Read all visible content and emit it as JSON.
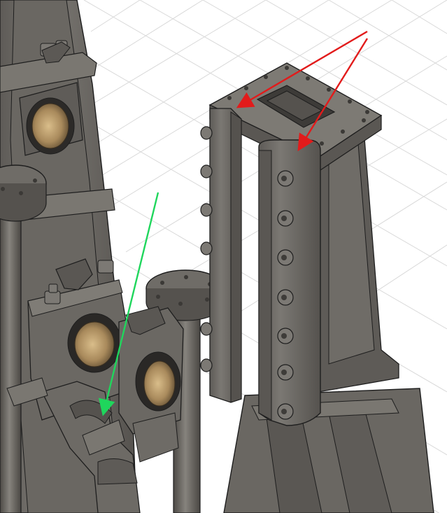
{
  "viewport": {
    "background": "#ffffff",
    "grid_color": "#d9d9d9"
  },
  "model": {
    "body_color": "#6e6b66",
    "shadow_color": "#4a4845",
    "edge_color": "#1e1e1e",
    "highlight_color": "#8a8781",
    "bronze_color": "#b89a6c",
    "bronze_shadow": "#6f5a3c",
    "bolt_color": "#7c7974"
  },
  "annotations": [
    {
      "name": "red-arrow-left",
      "color": "#e21b1b"
    },
    {
      "name": "red-arrow-right",
      "color": "#e21b1b"
    },
    {
      "name": "green-arrow",
      "color": "#1fd65c"
    }
  ]
}
